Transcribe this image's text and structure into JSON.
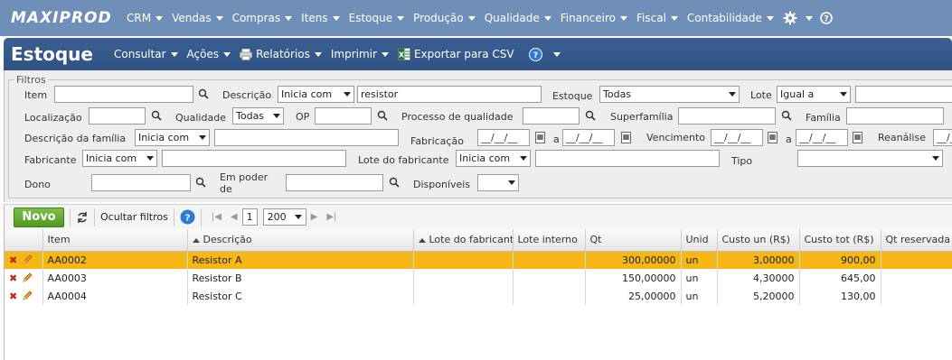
{
  "app": {
    "logo": "MAXIPROD",
    "menu": [
      "CRM",
      "Vendas",
      "Compras",
      "Itens",
      "Estoque",
      "Produção",
      "Qualidade",
      "Financeiro",
      "Fiscal",
      "Contabilidade"
    ],
    "settings_icon": "gear-icon",
    "help_icon": "help-icon"
  },
  "page": {
    "title": "Estoque",
    "toolbar": {
      "consultar": "Consultar",
      "acoes": "Ações",
      "relatorios": "Relatórios",
      "imprimir": "Imprimir",
      "exportar": "Exportar para CSV"
    }
  },
  "filters": {
    "legend": "Filtros",
    "item_label": "Item",
    "descricao_label": "Descrição",
    "descricao_mode": "Inicia com",
    "descricao_value": "resistor",
    "estoque_label": "Estoque",
    "estoque_value": "Todas",
    "lote_label": "Lote",
    "lote_mode": "Igual a",
    "localizacao_label": "Localização",
    "qualidade_label": "Qualidade",
    "qualidade_value": "Todas",
    "op_label": "OP",
    "processo_label": "Processo de qualidade",
    "superfamilia_label": "Superfamília",
    "familia_label": "Família",
    "descfamilia_label": "Descrição da família",
    "descfamilia_mode": "Inicia com",
    "fabricacao_label": "Fabricação",
    "date_placeholder": "__/__/__",
    "a_label": "a",
    "vencimento_label": "Vencimento",
    "reanalise_label": "Reanálise",
    "fabricante_label": "Fabricante",
    "fabricante_mode": "Inicia com",
    "lotefab_label": "Lote do fabricante",
    "lotefab_mode": "Inicia com",
    "tipo_label": "Tipo",
    "dono_label": "Dono",
    "empoder_label": "Em poder de",
    "disponiveis_label": "Disponíveis"
  },
  "grid_toolbar": {
    "novo": "Novo",
    "ocultar_filtros": "Ocultar filtros",
    "page": "1",
    "page_size": "200"
  },
  "table": {
    "headers": [
      "Item",
      "Descrição",
      "Lote do fabricante",
      "Lote interno",
      "Qt",
      "Unid",
      "Custo un (R$)",
      "Custo tot (R$)",
      "Qt reservada"
    ],
    "rows": [
      {
        "item": "AA0002",
        "descricao": "Resistor A",
        "lote_fab": "",
        "lote_int": "",
        "qt": "300,00000",
        "unid": "un",
        "custo_un": "3,00000",
        "custo_tot": "900,00",
        "qt_res": ""
      },
      {
        "item": "AA0003",
        "descricao": "Resistor B",
        "lote_fab": "",
        "lote_int": "",
        "qt": "150,00000",
        "unid": "un",
        "custo_un": "4,30000",
        "custo_tot": "645,00",
        "qt_res": ""
      },
      {
        "item": "AA0004",
        "descricao": "Resistor C",
        "lote_fab": "",
        "lote_int": "",
        "qt": "25,00000",
        "unid": "un",
        "custo_un": "5,20000",
        "custo_tot": "130,00",
        "qt_res": ""
      }
    ],
    "selected_row": 0
  },
  "colors": {
    "nav_bg": "#6f8fb8",
    "title_bg": "#2f5283",
    "selected_row": "#f6b715",
    "novo_button": "#4f9a1f"
  }
}
